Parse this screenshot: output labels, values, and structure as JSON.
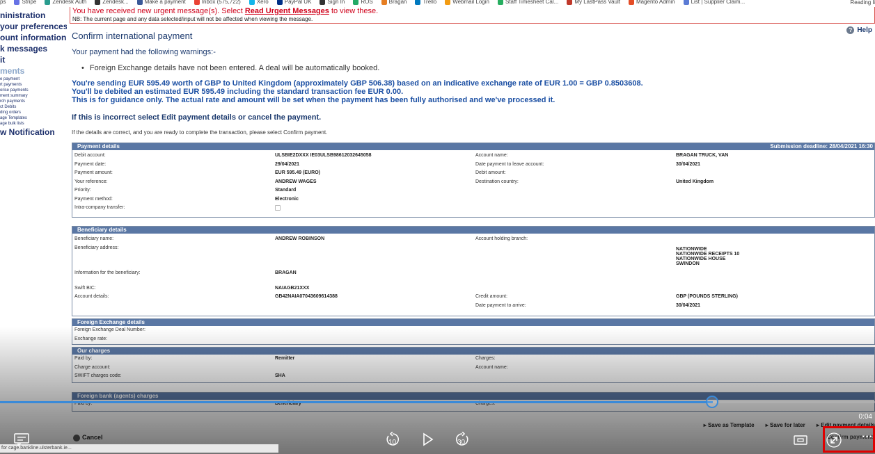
{
  "bookmarks": [
    "ps",
    "Stripe",
    "Zendesk Auth",
    "Zendesk...",
    "Make a payment",
    "Inbox (575,722)",
    "Xero",
    "PayPal UK",
    "Sign In",
    "ROS",
    "Bragan",
    "Trello",
    "Webmail Login",
    "Staff Timesheet Cal...",
    "My LastPass Vault",
    "Magento Admin",
    "List | Supplier Claim..."
  ],
  "bookmarks_right": "Reading li",
  "leftnav": {
    "items": [
      "ninistration",
      "your preferences",
      "ount information",
      "k messages",
      "it"
    ],
    "section": "ments",
    "subs": [
      "e payment",
      "rt payments",
      "orise payments",
      "ment summary",
      "rch payments",
      "ct Debits",
      "ding orders",
      "age Templates",
      "age bulk lists"
    ],
    "notification": "w Notification"
  },
  "notice": {
    "line1_pre": "You have received new urgent message(s). Select ",
    "line1_link": "Read Urgent Messages",
    "line1_post": " to view these.",
    "line2": "NB: The current page and any data selected/input will not be affected when viewing the message."
  },
  "page": {
    "title": "Confirm international payment",
    "help": "Help",
    "warnings_intro": "Your payment had the following warnings:-",
    "warning_1": "Foreign Exchange details have not been entered. A deal will be automatically booked.",
    "summary_1": "You're sending EUR 595.49 worth of GBP to United Kingdom (approximately GBP 506.38) based on an indicative exchange rate of EUR 1.00 = GBP 0.8503608.",
    "summary_2": "You'll be debited an estimated EUR 595.49 including the standard transaction fee EUR 0.00.",
    "summary_3": "This is for guidance only. The actual rate and amount will be set when the payment has been fully authorised and we've processed it.",
    "incorrect": "If this is incorrect select Edit payment details or cancel the payment.",
    "complete": "If the details are correct, and you are ready to complete the transaction, please select Confirm payment."
  },
  "payment_details": {
    "title": "Payment details",
    "deadline": "Submission deadline: 28/04/2021 16:30",
    "rows": [
      [
        "Debit account:",
        "ULSBIE2DXXX  IE03ULSB98612032645058",
        "Account name:",
        "BRAGAN TRUCK, VAN"
      ],
      [
        "Payment date:",
        "29/04/2021",
        "Date payment to leave account:",
        "30/04/2021"
      ],
      [
        "Payment amount:",
        "EUR 595.49 (EURO)",
        "Debit amount:",
        ""
      ],
      [
        "Your reference:",
        "ANDREW WAGES",
        "Destination country:",
        "United Kingdom"
      ],
      [
        "Priority:",
        "Standard",
        "",
        ""
      ],
      [
        "Payment method:",
        "Electronic",
        "",
        ""
      ],
      [
        "Intra-company transfer:",
        "",
        "",
        ""
      ]
    ]
  },
  "beneficiary_details": {
    "title": "Beneficiary details",
    "name_label": "Beneficiary name:",
    "name": "ANDREW ROBINSON",
    "branch_label": "Account holding branch:",
    "address_label": "Beneficiary address:",
    "branch_lines": [
      "NATIONWIDE",
      "NATIONWIDE RECEIPTS 10",
      "NATIONWIDE HOUSE",
      "SWINDON"
    ],
    "info_label": "Information for the beneficiary:",
    "info": "BRAGAN",
    "swift_label": "Swift BIC:",
    "swift": "NAIAGB21XXX",
    "account_label": "Account details:",
    "account": "GB42NAIA07043609614388",
    "credit_label": "Credit amount:",
    "credit": "GBP  (POUNDS STERLING)",
    "arrive_label": "Date payment to arrive:",
    "arrive": "30/04/2021"
  },
  "fx_details": {
    "title": "Foreign Exchange details",
    "deal_label": "Foreign Exchange Deal Number:",
    "rate_label": "Exchange rate:"
  },
  "our_charges": {
    "title": "Our charges",
    "paid_by_label": "Paid by:",
    "paid_by": "Remitter",
    "charges_label": "Charges:",
    "charge_account_label": "Charge account:",
    "account_name_label": "Account name:",
    "swift_code_label": "SWIFT charges code:",
    "swift_code": "SHA"
  },
  "foreign_charges": {
    "title": "Foreign bank (agents) charges",
    "paid_by_label": "Paid by:",
    "paid_by": "Beneficiary",
    "charges_label": "Charges:"
  },
  "actions": {
    "save_template": "Save as Template",
    "save_later": "Save for later",
    "edit": "Edit payment details",
    "cancel": "Cancel",
    "confirm": "Confirm payment"
  },
  "video": {
    "progress": 0.815,
    "time": "0:04",
    "rewind_seconds": "10",
    "forward_seconds": "30"
  },
  "status_url": "for cage.bankline.ulsterbank.ie..."
}
